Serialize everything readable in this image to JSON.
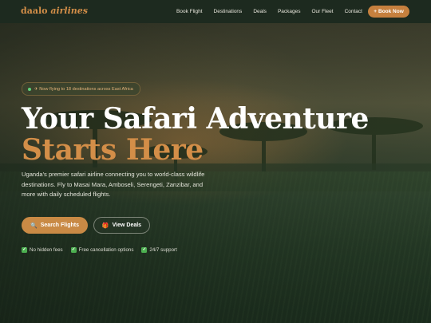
{
  "brand": {
    "name_a": "daalo",
    "name_b": "airlines"
  },
  "nav": {
    "links": [
      "Book Flight",
      "Destinations",
      "Deals",
      "Packages",
      "Our Fleet",
      "Contact"
    ],
    "cta": "Book Now",
    "cta_icon": "plus-icon"
  },
  "hero": {
    "badge": "✈ Now flying to 18 destinations across East Africa",
    "title_line1": "Your Safari Adventure",
    "title_line2": "Starts Here",
    "description": "Uganda's premier safari airline connecting you to world-class wildlife destinations. Fly to Masai Mara, Amboseli, Serengeti, Zanzibar, and more with daily scheduled flights.",
    "primary_button": "Search Flights",
    "primary_icon": "search-icon",
    "secondary_button": "View Deals",
    "secondary_icon": "gift-icon",
    "features": [
      "No hidden fees",
      "Free cancellation options",
      "24/7 support"
    ]
  },
  "colors": {
    "accent": "#c98a45",
    "nav_bg": "#1d2a1f",
    "check_green": "#4caf50",
    "status_dot": "#5fd07a"
  }
}
